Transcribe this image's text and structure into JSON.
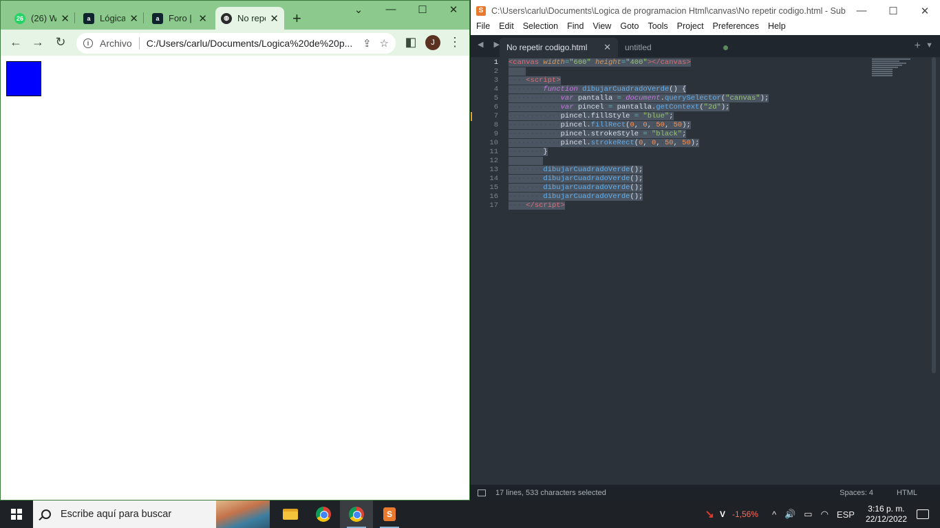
{
  "chrome": {
    "tabs": [
      {
        "title": "(26) W",
        "favicon": "whatsapp-icon",
        "badge": "26"
      },
      {
        "title": "Lógica",
        "favicon": "alura-icon",
        "badge": "a"
      },
      {
        "title": "Foro | A",
        "favicon": "alura-icon",
        "badge": "a"
      },
      {
        "title": "No repe",
        "favicon": "globe-icon",
        "badge": ""
      }
    ],
    "new_tab": "+",
    "minimize": "⌄",
    "min": "—",
    "max": "☐",
    "close": "✕",
    "back": "←",
    "forward": "→",
    "reload": "↻",
    "info": "i",
    "scheme": "Archivo",
    "url": "C:/Users/carlu/Documents/Logica%20de%20p...",
    "share": "⇪",
    "star": "☆",
    "sidepanel": "◧",
    "avatar": "J",
    "menu": "⋮",
    "square_color": "#0000ff"
  },
  "sublime": {
    "title": "C:\\Users\\carlu\\Documents\\Logica de programacion Html\\canvas\\No repetir codigo.html - Sub...",
    "logo": "S",
    "min": "—",
    "max": "☐",
    "close": "✕",
    "menu": [
      "File",
      "Edit",
      "Selection",
      "Find",
      "View",
      "Goto",
      "Tools",
      "Project",
      "Preferences",
      "Help"
    ],
    "tabs": [
      {
        "title": "No repetir codigo.html",
        "close": "✕"
      },
      {
        "title": "untitled",
        "close": ""
      }
    ],
    "nav": "◀ ▶",
    "plus": "+",
    "chevron": "▼",
    "line_numbers": [
      "1",
      "2",
      "3",
      "4",
      "5",
      "6",
      "7",
      "8",
      "9",
      "10",
      "11",
      "12",
      "13",
      "14",
      "15",
      "16",
      "17"
    ],
    "status": {
      "selection": "17 lines, 533 characters selected",
      "spaces": "Spaces: 4",
      "syntax": "HTML"
    }
  },
  "taskbar": {
    "search_placeholder": "Escribe aquí para buscar",
    "stock_symbol": "V",
    "stock_change": "-1,56%",
    "chevron": "^",
    "volume": "🔊",
    "battery": "▭",
    "wifi": "◠",
    "lang": "ESP",
    "time": "3:16 p. m.",
    "date": "22/12/2022"
  }
}
